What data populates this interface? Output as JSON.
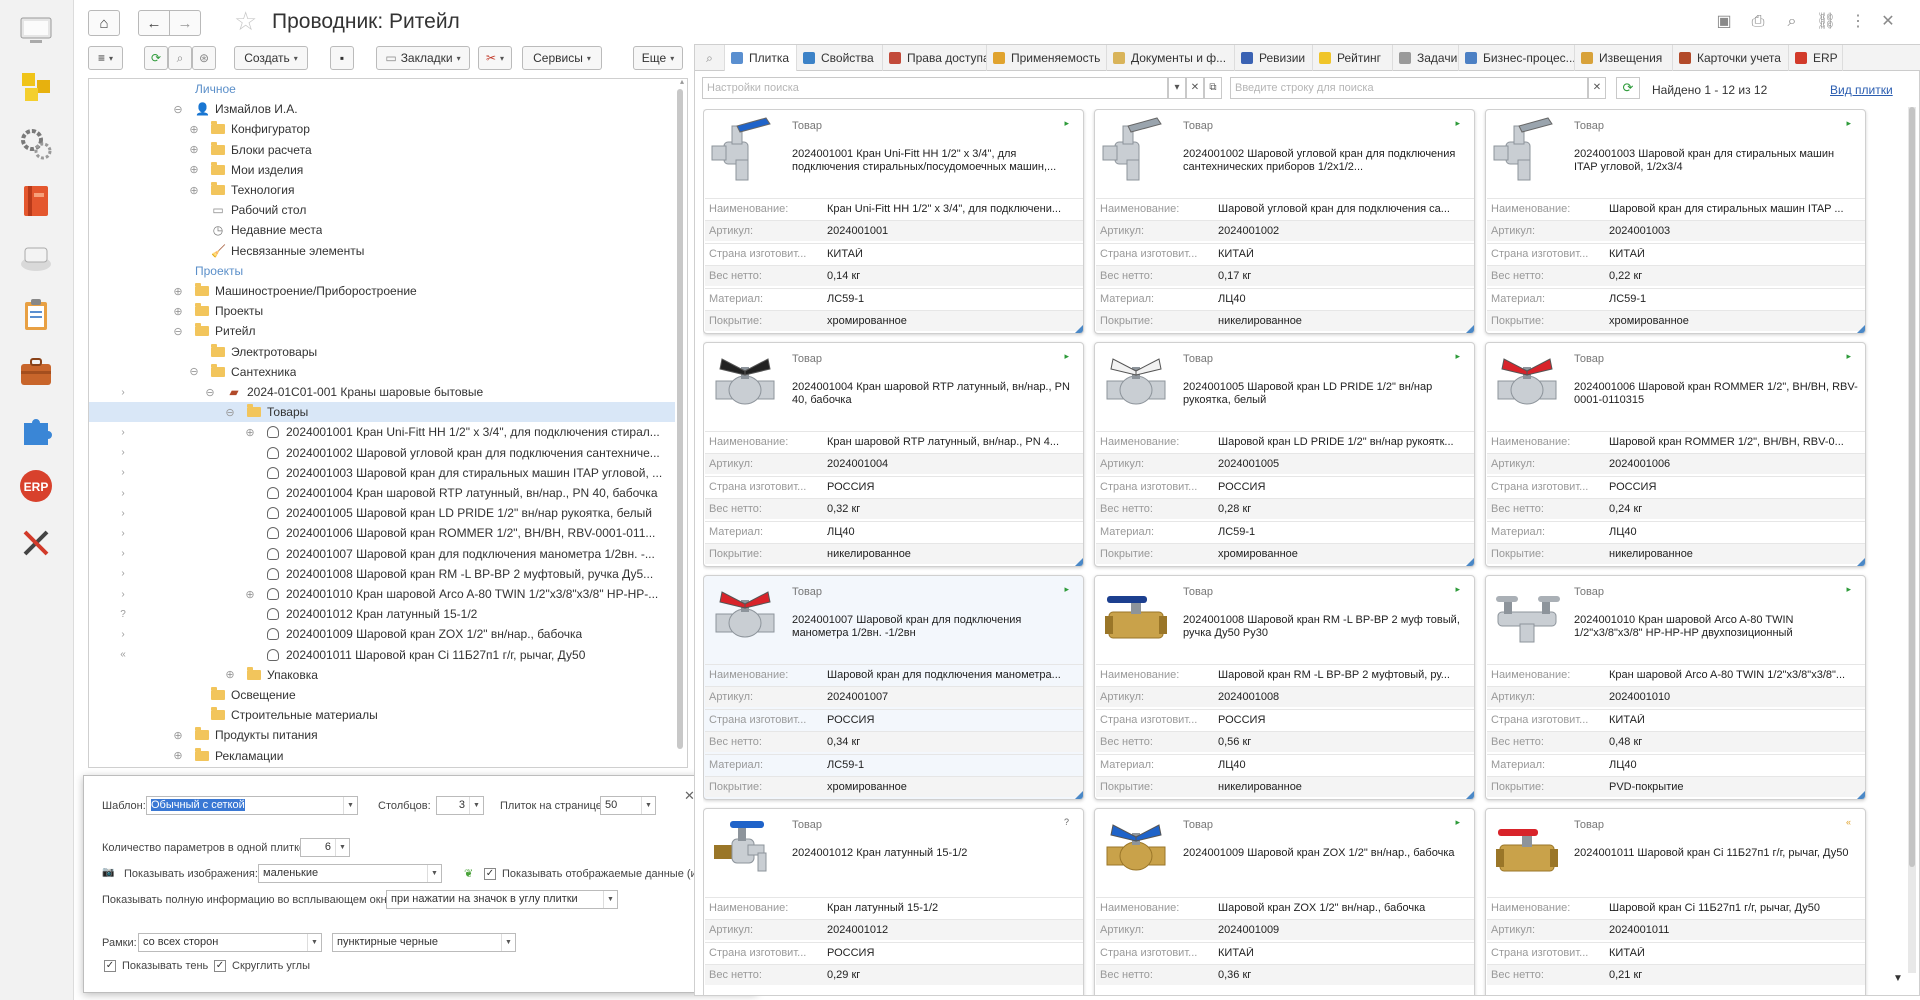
{
  "window": {
    "title": "Проводник: Ритейл"
  },
  "left_sidebar": [
    {
      "icon": "desktop-icon"
    },
    {
      "icon": "blocks-icon"
    },
    {
      "icon": "gears-icon"
    },
    {
      "icon": "book-icon"
    },
    {
      "icon": "printer-icon"
    },
    {
      "icon": "clipboard-icon"
    },
    {
      "icon": "briefcase-icon"
    },
    {
      "icon": "puzzle-icon"
    },
    {
      "icon": "erp-icon",
      "label": "ERP"
    },
    {
      "icon": "tools-icon"
    }
  ],
  "toolbar": {
    "create": "Создать",
    "bookmarks": "Закладки",
    "services": "Сервисы",
    "more": "Еще"
  },
  "tree": [
    {
      "text": "Личное",
      "kind": "group",
      "indent": 0
    },
    {
      "text": "Измайлов И.А.",
      "kind": "user",
      "indent": 0,
      "exp": "⊖"
    },
    {
      "text": "Конфигуратор",
      "kind": "folder",
      "indent": 1,
      "exp": "⊕"
    },
    {
      "text": "Блоки расчета",
      "kind": "folder",
      "indent": 1,
      "exp": "⊕"
    },
    {
      "text": "Мои изделия",
      "kind": "folder",
      "indent": 1,
      "exp": "⊕"
    },
    {
      "text": "Технология",
      "kind": "folder",
      "indent": 1,
      "exp": "⊕"
    },
    {
      "text": "Рабочий стол",
      "kind": "desk",
      "indent": 1
    },
    {
      "text": "Недавние места",
      "kind": "clock",
      "indent": 1
    },
    {
      "text": "Несвязанные элементы",
      "kind": "broom",
      "indent": 1
    },
    {
      "text": "Проекты",
      "kind": "group",
      "indent": 0
    },
    {
      "text": "Машиностроение/Приборостроение",
      "kind": "folder",
      "indent": 0,
      "exp": "⊕"
    },
    {
      "text": "Проекты",
      "kind": "folder",
      "indent": 0,
      "exp": "⊕"
    },
    {
      "text": "Ритейл",
      "kind": "folder",
      "indent": 0,
      "exp": "⊖"
    },
    {
      "text": "Электротовары",
      "kind": "folder",
      "indent": 1
    },
    {
      "text": "Сантехника",
      "kind": "folder",
      "indent": 1,
      "exp": "⊖"
    },
    {
      "text": "2024-01С01-001 Краны шаровые бытовые",
      "kind": "catalog",
      "indent": 2,
      "exp": "⊖",
      "mark": "›"
    },
    {
      "text": "Товары",
      "kind": "folder",
      "indent": 3,
      "exp": "⊖",
      "selected": true
    },
    {
      "text": "2024001001 Кран Uni-Fitt HH 1/2\" x 3/4\", для подключения стирал...",
      "kind": "product",
      "indent": 4,
      "exp": "⊕",
      "mark": "›"
    },
    {
      "text": "2024001002 Шаровой угловой кран для подключения сантехниче...",
      "kind": "product",
      "indent": 4,
      "mark": "›"
    },
    {
      "text": "2024001003 Шаровой кран для стиральных машин ITAP угловой, ...",
      "kind": "product",
      "indent": 4,
      "mark": "›"
    },
    {
      "text": "2024001004 Кран шаровой RTP латунный, вн/нар., PN 40, бабочка",
      "kind": "product",
      "indent": 4,
      "mark": "›"
    },
    {
      "text": "2024001005 Шаровой кран LD PRIDE 1/2\" вн/нар рукоятка, белый",
      "kind": "product",
      "indent": 4,
      "mark": "›"
    },
    {
      "text": "2024001006 Шаровой кран ROMMER 1/2\", ВН/ВН, RBV-0001-011...",
      "kind": "product",
      "indent": 4,
      "mark": "›"
    },
    {
      "text": "2024001007 Шаровой кран для подключения манометра 1/2вн. -...",
      "kind": "product",
      "indent": 4,
      "mark": "›"
    },
    {
      "text": "2024001008 Шаровой кран RM -L ВР-ВР 2 муфтовый, ручка Ду5...",
      "kind": "product",
      "indent": 4,
      "mark": "›"
    },
    {
      "text": "2024001010 Кран шаровой Arco A-80 TWIN 1/2\"x3/8\"x3/8\" HP-HP-...",
      "kind": "product",
      "indent": 4,
      "exp": "⊕",
      "mark": "›"
    },
    {
      "text": "2024001012 Кран латунный 15-1/2",
      "kind": "product",
      "indent": 4,
      "mark": "?"
    },
    {
      "text": "2024001009 Шаровой кран ZOX 1/2\" вн/нар., бабочка",
      "kind": "product",
      "indent": 4,
      "mark": "›"
    },
    {
      "text": "2024001011 Шаровой кран Ci 11Б27п1 г/г, рычаг, Ду50",
      "kind": "product",
      "indent": 4,
      "mark": "«"
    },
    {
      "text": "Упаковка",
      "kind": "folder",
      "indent": 3,
      "exp": "⊕"
    },
    {
      "text": "Освещение",
      "kind": "folder",
      "indent": 1
    },
    {
      "text": "Строительные материалы",
      "kind": "folder",
      "indent": 1
    },
    {
      "text": "Продукты питания",
      "kind": "folder",
      "indent": 0,
      "exp": "⊕"
    },
    {
      "text": "Рекламации",
      "kind": "folder",
      "indent": 0,
      "exp": "⊕"
    }
  ],
  "settings_dialog": {
    "template_label": "Шаблон:",
    "template_value": "Обычный с сеткой",
    "columns_label": "Столбцов:",
    "columns_value": "3",
    "per_page_label": "Плиток на странице:",
    "per_page_value": "50",
    "params_label": "Количество параметров в одной плитке:",
    "params_value": "6",
    "images_label": "Показывать изображения:",
    "images_value": "маленькие",
    "show_icons_label": "Показывать отображаемые данные (иконки)",
    "popup_label": "Показывать полную информацию во всплывающем окне:",
    "popup_value": "при нажатии на значок в углу плитки",
    "frames_label": "Рамки:",
    "frames_sides_value": "со всех сторон",
    "frames_style_value": "пунктирные черные",
    "shadow_label": "Показывать тень",
    "round_label": "Скруглить углы"
  },
  "tabs": [
    {
      "label": "Плитка",
      "active": true,
      "color": "#5a8fd0"
    },
    {
      "label": "Свойства",
      "color": "#3c82c7"
    },
    {
      "label": "Права доступа",
      "color": "#c24a3a"
    },
    {
      "label": "Применяемость",
      "color": "#e0a32e"
    },
    {
      "label": "Документы и ф...",
      "color": "#d9b45a"
    },
    {
      "label": "Ревизии",
      "color": "#3a62b3"
    },
    {
      "label": "Рейтинг",
      "color": "#f0c52a"
    },
    {
      "label": "Задачи",
      "color": "#9a9a9a"
    },
    {
      "label": "Бизнес-процес...",
      "color": "#4c80c4"
    },
    {
      "label": "Извещения",
      "color": "#d8a23a"
    },
    {
      "label": "Карточки учета",
      "color": "#b24a2a"
    },
    {
      "label": "ERP",
      "color": "#d23a2a"
    }
  ],
  "search": {
    "settings_placeholder": "Настройки поиска",
    "query_placeholder": "Введите строку для поиска",
    "found": "Найдено 1 - 12 из 12",
    "view_link": "Вид плитки"
  },
  "field_labels": [
    "Наименование:",
    "Артикул:",
    "Страна изготовит...",
    "Вес нетто:",
    "Материал:",
    "Покрытие:"
  ],
  "cards": [
    {
      "type": "Товар",
      "title": "2024001001 Кран Uni-Fitt HH 1/2\" x 3/4\", для подключения стиральных/посудомоечных машин,...",
      "image": "angle-valve-blue",
      "mark": "▸",
      "values": [
        "Кран Uni-Fitt HH 1/2\" x 3/4\", для подключени...",
        "2024001001",
        "КИТАЙ",
        "0,14 кг",
        "ЛС59-1",
        "хромированное"
      ]
    },
    {
      "type": "Товар",
      "title": "2024001002 Шаровой угловой кран для подключения сантехнических приборов 1/2х1/2...",
      "image": "angle-valve-chrome",
      "mark": "▸",
      "values": [
        "Шаровой угловой кран для подключения са...",
        "2024001002",
        "КИТАЙ",
        "0,17 кг",
        "ЛЦ40",
        "никелированное"
      ]
    },
    {
      "type": "Товар",
      "title": "2024001003 Шаровой кран для стиральных машин ITAP угловой, 1/2х3/4",
      "image": "angle-valve-chrome",
      "mark": "▸",
      "values": [
        "Шаровой кран для стиральных машин ITAP ...",
        "2024001003",
        "КИТАЙ",
        "0,22 кг",
        "ЛС59-1",
        "хромированное"
      ]
    },
    {
      "type": "Товар",
      "title": "2024001004 Кран шаровой RTP латунный, вн/нар., PN 40, бабочка",
      "image": "ball-valve-black",
      "mark": "▸",
      "values": [
        "Кран шаровой RTP латунный, вн/нар., PN 4...",
        "2024001004",
        "РОССИЯ",
        "0,32 кг",
        "ЛЦ40",
        "никелированное"
      ]
    },
    {
      "type": "Товар",
      "title": "2024001005 Шаровой кран LD PRIDE 1/2\" вн/нар рукоятка, белый",
      "image": "ball-valve-white",
      "mark": "▸",
      "values": [
        "Шаровой кран LD PRIDE 1/2\" вн/нар рукоятк...",
        "2024001005",
        "РОССИЯ",
        "0,28 кг",
        "ЛС59-1",
        "хромированное"
      ]
    },
    {
      "type": "Товар",
      "title": "2024001006 Шаровой кран ROMMER 1/2\", ВН/ВН, RBV-0001-0110315",
      "image": "ball-valve-red",
      "mark": "▸",
      "values": [
        "Шаровой кран ROMMER 1/2\", ВН/ВН, RBV-0...",
        "2024001006",
        "РОССИЯ",
        "0,24 кг",
        "ЛЦ40",
        "никелированное"
      ]
    },
    {
      "type": "Товар",
      "title": "2024001007 Шаровой кран для подключения манометра 1/2вн. -1/2вн",
      "image": "ball-valve-red",
      "mark": "▸",
      "highlight": true,
      "values": [
        "Шаровой кран для подключения манометра...",
        "2024001007",
        "РОССИЯ",
        "0,34 кг",
        "ЛС59-1",
        "хромированное"
      ]
    },
    {
      "type": "Товар",
      "title": "2024001008 Шаровой кран RM -L ВР-ВР 2 муф товый, ручка Ду50 Ру30",
      "image": "lever-valve-brass",
      "mark": "▸",
      "values": [
        "Шаровой кран RM -L ВР-ВР 2 муфтовый, ру...",
        "2024001008",
        "РОССИЯ",
        "0,56 кг",
        "ЛЦ40",
        "никелированное"
      ]
    },
    {
      "type": "Товар",
      "title": "2024001010 Кран шаровой Arco A-80 TWIN 1/2\"x3/8\"x3/8\" HP-HP-HP двухпозиционный",
      "image": "twin-valve-chrome",
      "mark": "▸",
      "values": [
        "Кран шаровой Arco A-80 TWIN 1/2\"x3/8\"x3/8\"...",
        "2024001010",
        "КИТАЙ",
        "0,48 кг",
        "ЛЦ40",
        "PVD-покрытие"
      ]
    },
    {
      "type": "Товар",
      "title": "2024001012 Кран латунный 15-1/2",
      "image": "garden-tap",
      "mark": "?",
      "values": [
        "Кран латунный 15-1/2",
        "2024001012",
        "РОССИЯ",
        "0,29 кг"
      ]
    },
    {
      "type": "Товар",
      "title": "2024001009 Шаровой кран ZOX 1/2\" вн/нар., бабочка",
      "image": "ball-valve-blue",
      "mark": "▸",
      "values": [
        "Шаровой кран ZOX 1/2\" вн/нар., бабочка",
        "2024001009",
        "КИТАЙ",
        "0,36 кг"
      ]
    },
    {
      "type": "Товар",
      "title": "2024001011 Шаровой кран Ci 11Б27п1 г/г, рычаг, Ду50",
      "image": "lever-valve-red",
      "mark": "«",
      "values": [
        "Шаровой кран Ci 11Б27п1 г/г, рычаг, Ду50",
        "2024001011",
        "КИТАЙ",
        "0,21 кг"
      ]
    }
  ]
}
